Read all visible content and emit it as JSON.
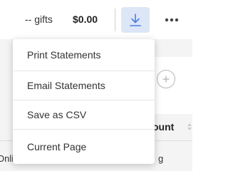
{
  "toolbar": {
    "gifts_label": "-- gifts",
    "gifts_amount": "$0.00",
    "download_icon": "download-icon",
    "more_icon": "more-horizontal-icon",
    "download_color": "#4a7ee0",
    "download_bg": "#dde6f7"
  },
  "dropdown": {
    "items": [
      {
        "label": "Print Statements"
      },
      {
        "label": "Email Statements"
      },
      {
        "label": "Save as CSV"
      },
      {
        "label": "Current Page"
      }
    ]
  },
  "background": {
    "plus_icon": "plus-circle-icon",
    "column_header": "ount",
    "row_text_left": "Onli",
    "row_text_right": "g"
  }
}
